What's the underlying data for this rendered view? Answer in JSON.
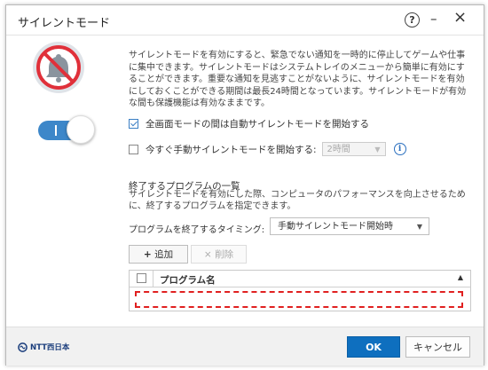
{
  "window": {
    "title": "サイレントモード"
  },
  "titlebar": {
    "help_icon": "?",
    "minimize_icon": "–",
    "close_icon": "×"
  },
  "description": "サイレントモードを有効にすると、緊急でない通知を一時的に停止してゲームや仕事に集中できます。サイレントモードはシステムトレイのメニューから簡単に有効にすることができます。重要な通知を見逃すことがないように、サイレントモードを有効にしておくことができる期間は最長24時間となっています。サイレントモードが有効な間も保護機能は有効なままです。",
  "toggle": {
    "state": "on",
    "on_glyph": "I"
  },
  "auto_fullscreen": {
    "label": "全画面モードの間は自動サイレントモードを開始する",
    "checked": true
  },
  "manual_start": {
    "label": "今すぐ手動サイレントモードを開始する:",
    "checked": false,
    "hours_value": "2時間"
  },
  "programs_section": {
    "heading": "終了するプログラムの一覧",
    "description": "サイレントモードを有効にした際、コンピュータのパフォーマンスを向上させるために、終了するプログラムを指定できます。",
    "timing_label": "プログラムを終了するタイミング:",
    "timing_value": "手動サイレントモード開始時",
    "add_label": "追加",
    "add_glyph": "+",
    "delete_label": "削除",
    "delete_glyph": "×",
    "column_header": "プログラム名"
  },
  "footer": {
    "brand": "NTT西日本",
    "ok_label": "OK",
    "cancel_label": "キャンセル"
  },
  "colors": {
    "accent": "#0e6fbf",
    "toggle": "#3d87c9",
    "badge_red": "#e0303a",
    "drop_zone": "#e02020"
  }
}
